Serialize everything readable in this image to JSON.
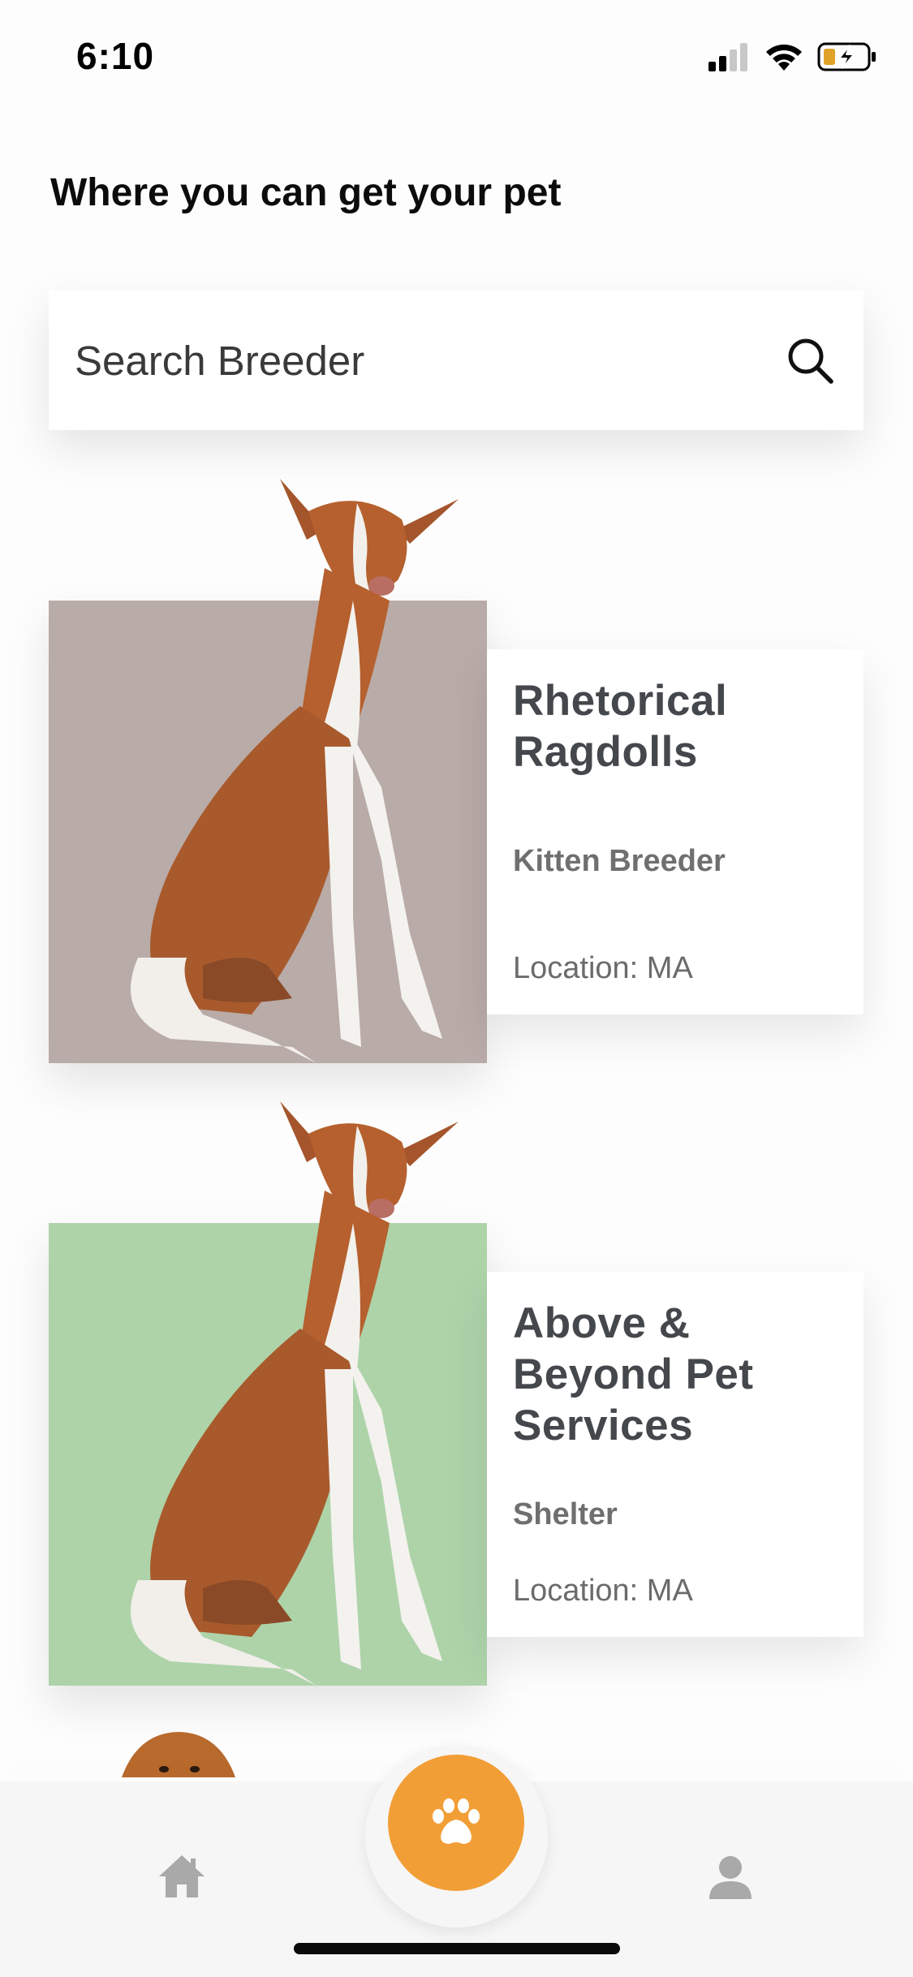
{
  "status_bar": {
    "time": "6:10",
    "icons": [
      "signal-icon",
      "wifi-icon",
      "battery-charging-icon"
    ]
  },
  "page": {
    "title": "Where you can get your pet"
  },
  "search": {
    "placeholder": "Search Breeder",
    "value": "",
    "icon": "search-icon"
  },
  "breeders": [
    {
      "name": "Rhetorical Ragdolls",
      "type": "Kitten Breeder",
      "location": "Location: MA",
      "image_bg_color": "#b9aba7",
      "image": "dog-photo"
    },
    {
      "name": "Above & Beyond Pet Services",
      "type": "Shelter",
      "location": "Location: MA",
      "image_bg_color": "#aed3a9",
      "image": "dog-photo"
    }
  ],
  "tab_bar": {
    "items": [
      {
        "icon": "home-icon",
        "active": false
      },
      {
        "icon": "paw-icon",
        "active": true
      },
      {
        "icon": "profile-icon",
        "active": false
      }
    ],
    "accent_color": "#f29e36",
    "inactive_color": "#aaaaaa"
  }
}
